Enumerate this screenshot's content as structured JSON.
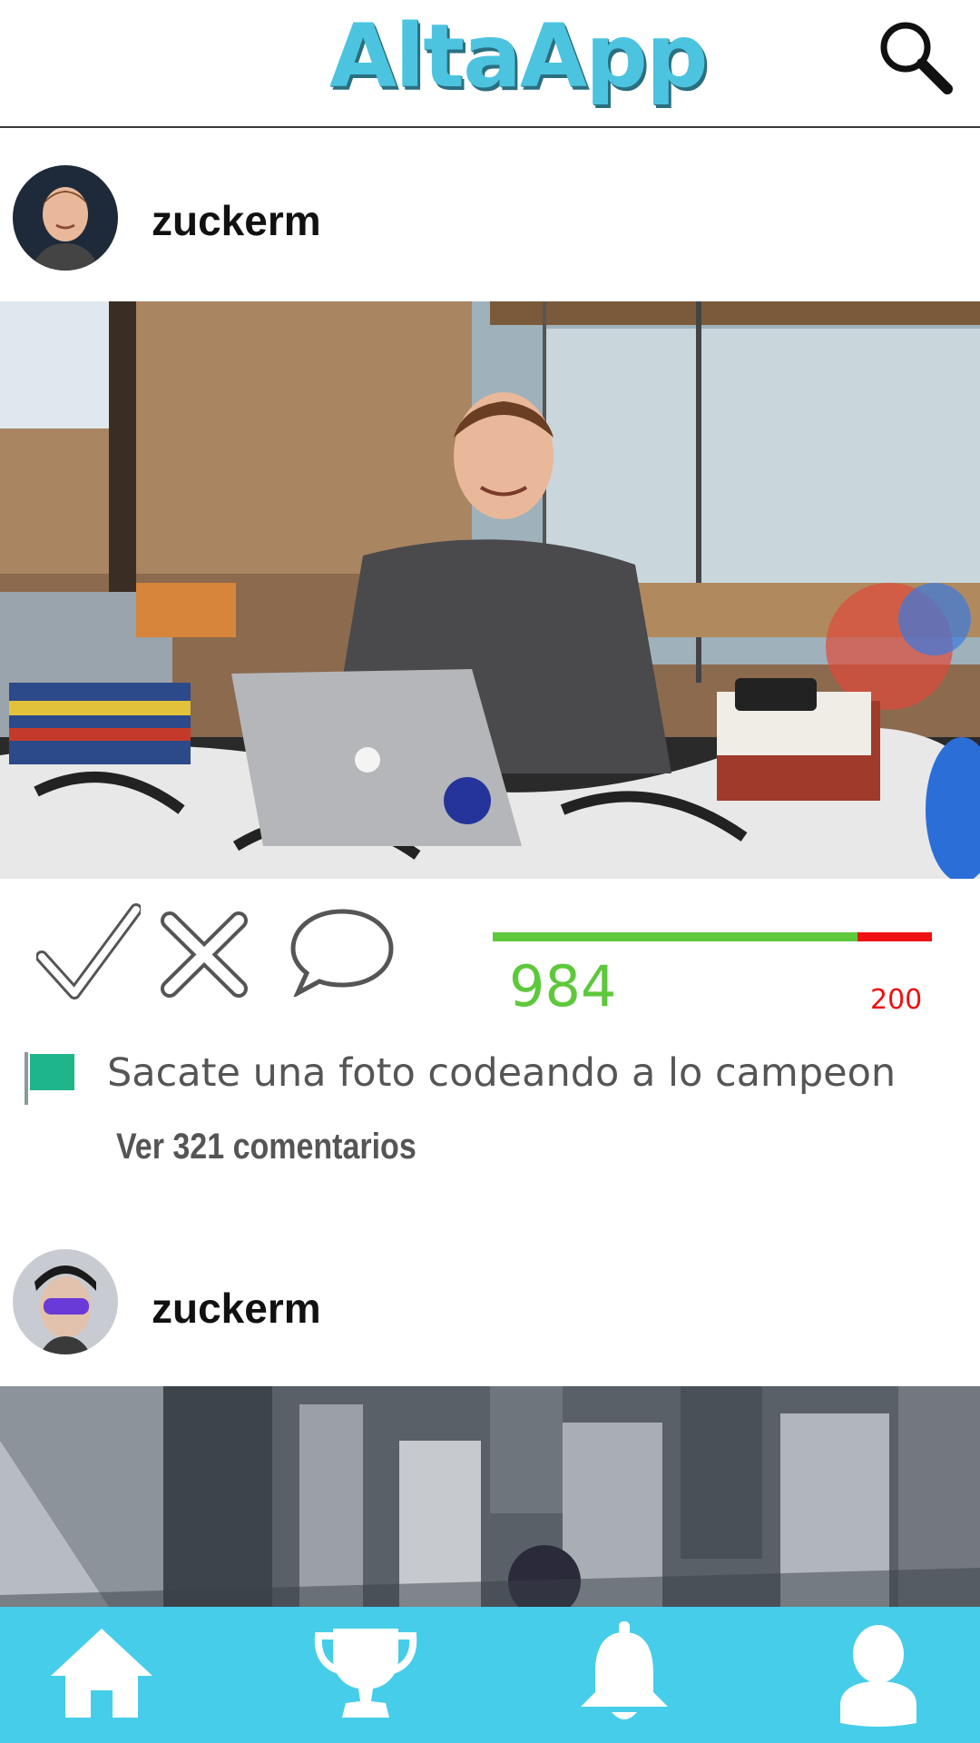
{
  "header": {
    "logo_text": "AltaApp",
    "search_icon": "search-icon"
  },
  "posts": [
    {
      "username": "zuckerm",
      "avatar_icon": "avatar-photo",
      "image": "office-laptop-photo",
      "actions": {
        "approve_icon": "check-icon",
        "reject_icon": "x-icon",
        "comment_icon": "speech-bubble-icon"
      },
      "votes": {
        "up": "984",
        "down": "200",
        "up_fraction": 0.831,
        "up_color": "#5ec83c",
        "down_color": "#ee1111"
      },
      "challenge": {
        "flag_icon": "flag-icon",
        "flag_color": "#1fb58a",
        "text": "Sacate una foto codeando a lo campeon"
      },
      "comments_label": "Ver 321 comentarios"
    },
    {
      "username": "zuckerm",
      "avatar_icon": "avatar-photo",
      "image": "city-aerial-photo"
    }
  ],
  "nav": {
    "background": "#46cde9",
    "items": [
      {
        "icon": "home-icon"
      },
      {
        "icon": "trophy-icon"
      },
      {
        "icon": "bell-icon"
      },
      {
        "icon": "profile-icon"
      }
    ]
  },
  "colors": {
    "logo": "#4cc4e0",
    "accent": "#46cde9"
  }
}
